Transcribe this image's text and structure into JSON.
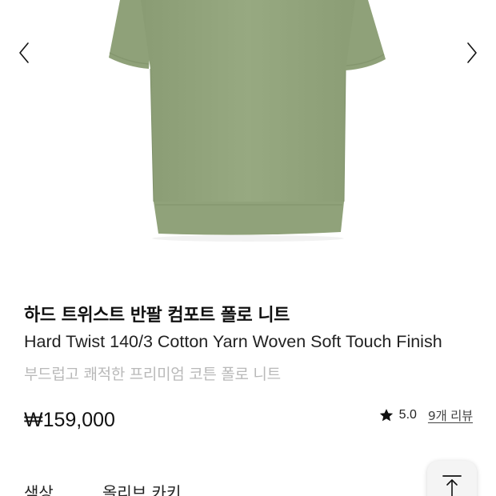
{
  "gallery": {
    "prev_icon": "chevron-left-icon",
    "next_icon": "chevron-right-icon"
  },
  "product": {
    "title_ko": "하드 트위스트 반팔 컴포트 폴로 니트",
    "title_en": "Hard Twist 140/3 Cotton Yarn Woven Soft Touch Finish",
    "description": "부드럽고 쾌적한 프리미엄 코튼 폴로 니트",
    "price": "₩159,000",
    "rating": "5.0",
    "reviews": "9개 리뷰"
  },
  "option": {
    "label": "색상",
    "value": "올리브 카키"
  },
  "colors": {
    "garment": "#94a67e",
    "accent": "#111111"
  },
  "scroll_top_icon": "arrow-up-to-top-icon"
}
